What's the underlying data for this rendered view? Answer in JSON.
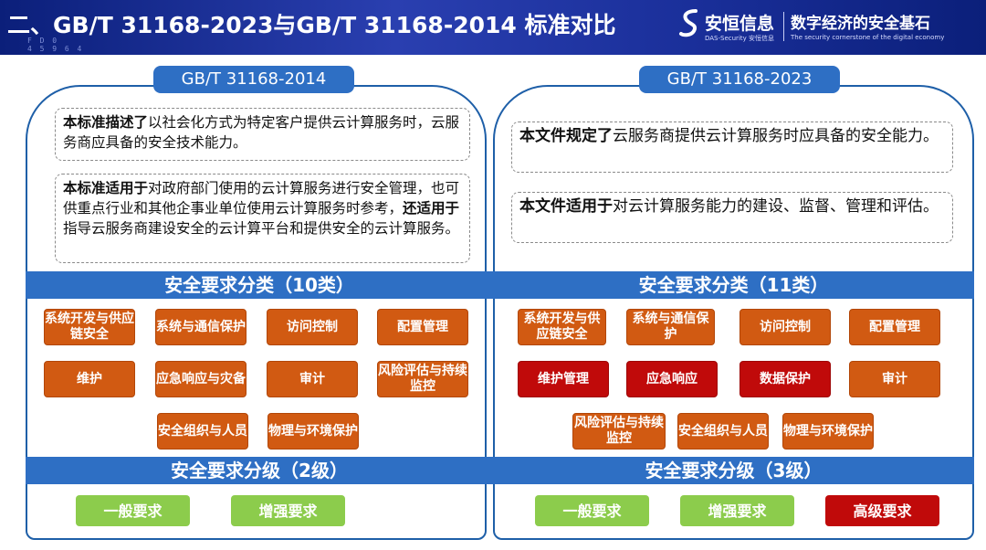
{
  "header": {
    "title": "二、GB/T 31168-2023与GB/T 31168-2014 标准对比",
    "deco_text": "F D 0\n4 5 9 6 4",
    "logo_cn": "安恒信息",
    "logo_en": "DAS-Security 安恒信息",
    "slogan": "数字经济的安全基石",
    "slogan_en": "The security cornerstone of the digital economy"
  },
  "left": {
    "standard": "GB/T 31168-2014",
    "desc1_bold": "本标准描述了",
    "desc1_text": "以社会化方式为特定客户提供云计算服务时，云服务商应具备的安全技术能力。",
    "desc2_bold": "本标准适用于",
    "desc2_text": "对政府部门使用的云计算服务进行安全管理，也可供重点行业和其他企事业单位使用云计算服务时参考，",
    "desc2_bold2": "还适用于",
    "desc2_text2": "指导云服务商建设安全的云计算平台和提供安全的云计算服务。",
    "category_title": "安全要求分类（10类）",
    "categories": [
      "系统开发与供应链安全",
      "系统与通信保护",
      "访问控制",
      "配置管理",
      "维护",
      "应急响应与灾备",
      "审计",
      "风险评估与持续监控",
      "安全组织与人员",
      "物理与环境保护"
    ],
    "level_title": "安全要求分级（2级）",
    "levels": [
      "一般要求",
      "增强要求"
    ]
  },
  "right": {
    "standard": "GB/T 31168-2023",
    "desc1_bold": "本文件规定了",
    "desc1_text": "云服务商提供云计算服务时应具备的安全能力。",
    "desc2_bold": "本文件适用于",
    "desc2_text": "对云计算服务能力的建设、监督、管理和评估。",
    "category_title": "安全要求分类（11类）",
    "categories": [
      "系统开发与供应链安全",
      "系统与通信保护",
      "访问控制",
      "配置管理",
      "维护管理",
      "应急响应",
      "数据保护",
      "审计",
      "风险评估与持续监控",
      "安全组织与人员",
      "物理与环境保护"
    ],
    "level_title": "安全要求分级（3级）",
    "levels": [
      "一般要求",
      "增强要求",
      "高级要求"
    ]
  },
  "colors": {
    "header_bg": "#1a2f9a",
    "accent_blue": "#2e6fc4",
    "category_orange": "#d15a12",
    "category_new_red": "#c00a0a",
    "level_green": "#8ccc4c",
    "level_high_red": "#c00a0a"
  }
}
